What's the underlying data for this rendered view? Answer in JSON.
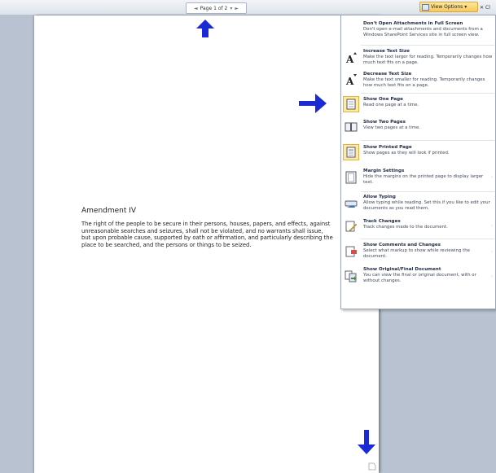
{
  "toolbar": {
    "pager_label": "Page 1 of 2",
    "pager_prev": "◄",
    "pager_dropdown": "▾",
    "pager_next": "►",
    "view_options_label": "View Options",
    "view_options_caret": "▾",
    "close_glyph": "✕",
    "close_label": "Cl"
  },
  "document": {
    "heading": "Amendment IV",
    "body": "The right of the people to be secure in their persons, houses, papers, and effects, against unreasonable searches and seizures, shall not be violated, and no warrants shall issue, but upon probable cause, supported by oath or affirmation, and particularly describing the place to be searched, and the persons or things to be seized."
  },
  "menu": {
    "items": [
      {
        "title": "Don't Open Attachments in Full Screen",
        "desc": "Don't open e-mail attachments and documents from a Windows SharePoint Services site in full screen view.",
        "icon": "none"
      },
      {
        "title": "Increase Text Size",
        "desc": "Make the text larger for reading. Temporarily changes how much text fits on a page.",
        "icon": "increase-text-icon"
      },
      {
        "title": "Decrease Text Size",
        "desc": "Make the text smaller for reading. Temporarily changes how much text fits on a page.",
        "icon": "decrease-text-icon"
      },
      {
        "title": "Show One Page",
        "desc": "Read one page at a time.",
        "icon": "one-page-icon"
      },
      {
        "title": "Show Two Pages",
        "desc": "View two pages at a time.",
        "icon": "two-pages-icon"
      },
      {
        "title": "Show Printed Page",
        "desc": "Show pages as they will look if printed.",
        "icon": "printed-page-icon"
      },
      {
        "title": "Margin Settings",
        "desc": "Hide the margins on the printed page to display larger text.",
        "icon": "margin-icon"
      },
      {
        "title": "Allow Typing",
        "desc": "Allow typing while reading. Set this if you like to edit your documents as you read them.",
        "icon": "typing-icon"
      },
      {
        "title": "Track Changes",
        "desc": "Track changes made to the document.",
        "icon": "track-changes-icon"
      },
      {
        "title": "Show Comments and Changes",
        "desc": "Select what markup to show while reviewing the document.",
        "icon": "comments-icon"
      },
      {
        "title": "Show Original/Final Document",
        "desc": "You can view the final or original document, with or without changes.",
        "icon": "original-final-icon"
      }
    ]
  },
  "colors": {
    "annotation_arrow": "#1a2bd6",
    "selection_fill": "#fde9a8",
    "selection_border": "#e2b23c",
    "workspace_bg": "#b8c2d1"
  }
}
